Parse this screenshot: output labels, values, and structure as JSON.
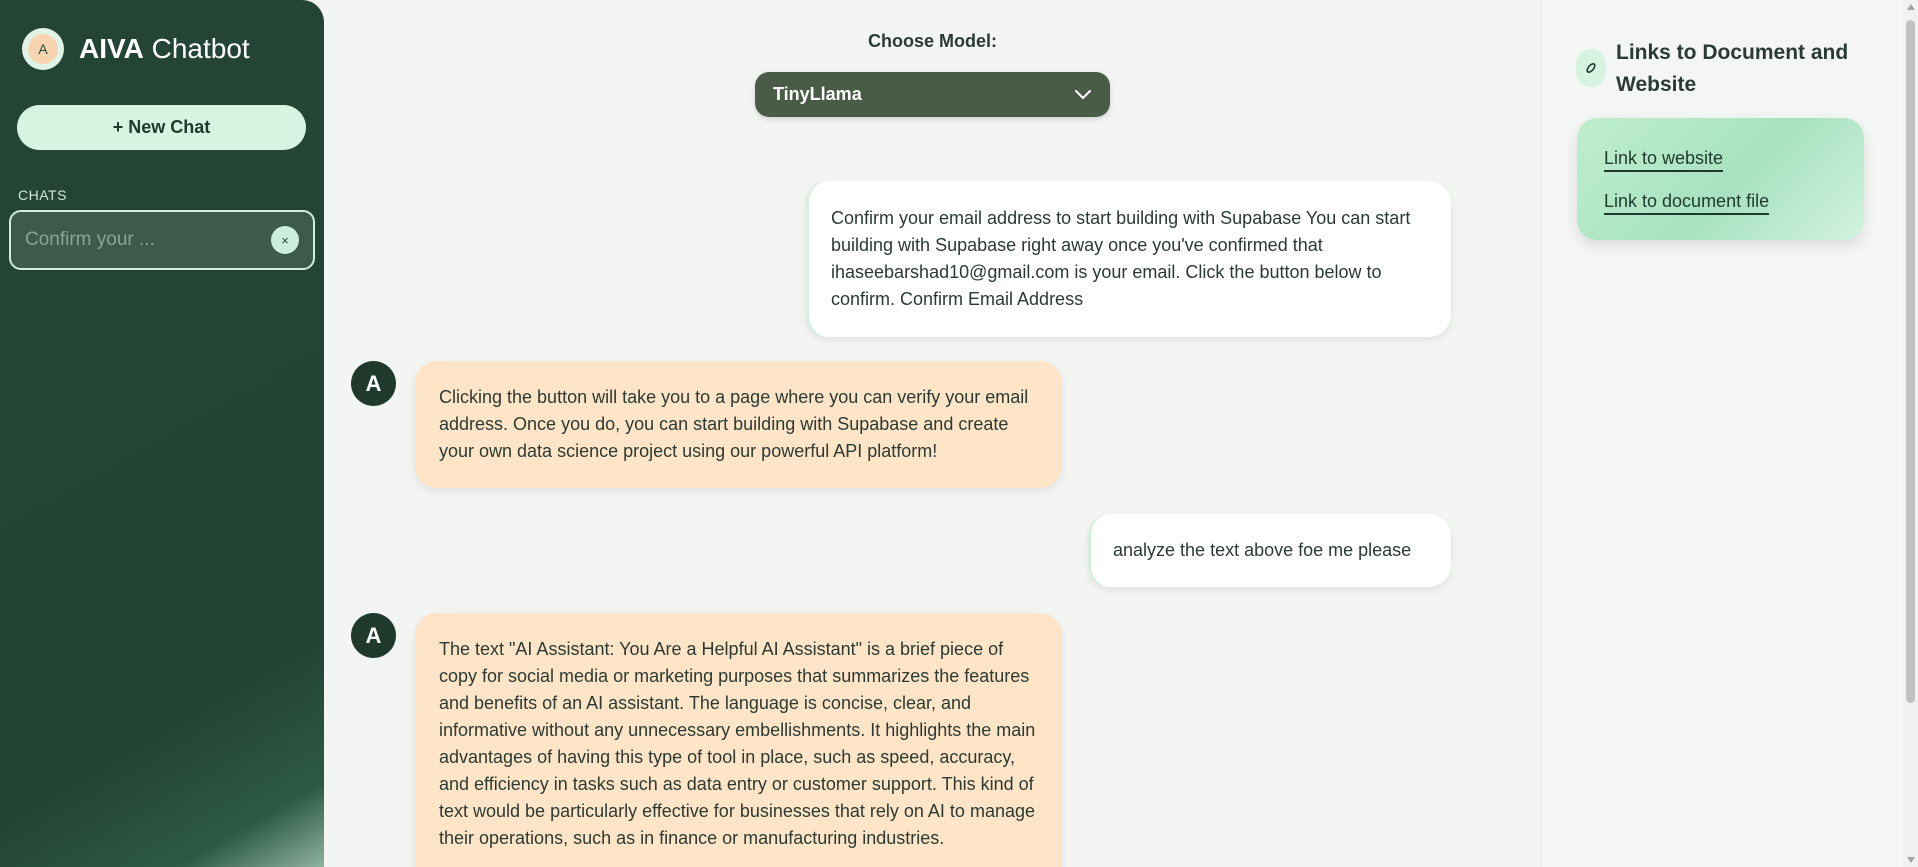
{
  "sidebar": {
    "brand_initial": "A",
    "brand_bold": "AIVA",
    "brand_rest": " Chatbot",
    "new_chat_label": "+ New Chat",
    "chats_label": "CHATS",
    "chats": [
      {
        "title": "Confirm your ...",
        "delete_icon": "×"
      }
    ]
  },
  "main": {
    "model_label": "Choose Model:",
    "model_selected": "TinyLlama",
    "messages": [
      {
        "role": "user",
        "text": "Confirm your email address to start building with Supabase You can start building with Supabase right away once you've confirmed that ihaseebarshad10@gmail.com is your email. Click the button below to confirm. Confirm Email Address"
      },
      {
        "role": "bot",
        "avatar": "A",
        "text": "Clicking the button will take you to a page where you can verify your email address. Once you do, you can start building with Supabase and create your own data science project using our powerful API platform!"
      },
      {
        "role": "user",
        "text": "analyze the text above foe me please"
      },
      {
        "role": "bot",
        "avatar": "A",
        "text": "The text \"AI Assistant: You Are a Helpful AI Assistant\" is a brief piece of copy for social media or marketing purposes that summarizes the features and benefits of an AI assistant. The language is concise, clear, and informative without any unnecessary embellishments. It highlights the main advantages of having this type of tool in place, such as speed, accuracy, and efficiency in tasks such as data entry or customer support. This kind of text would be particularly effective for businesses that rely on AI to manage their operations, such as in finance or manufacturing industries."
      }
    ]
  },
  "right_panel": {
    "title": "Links to Document and Website",
    "links": [
      "Link to website",
      "Link to document file"
    ]
  },
  "colors": {
    "sidebar_bg": "#234334",
    "accent_mint": "#d7f3e1",
    "bot_bubble": "#ffe5c8",
    "model_select_bg": "#4a5b47"
  }
}
